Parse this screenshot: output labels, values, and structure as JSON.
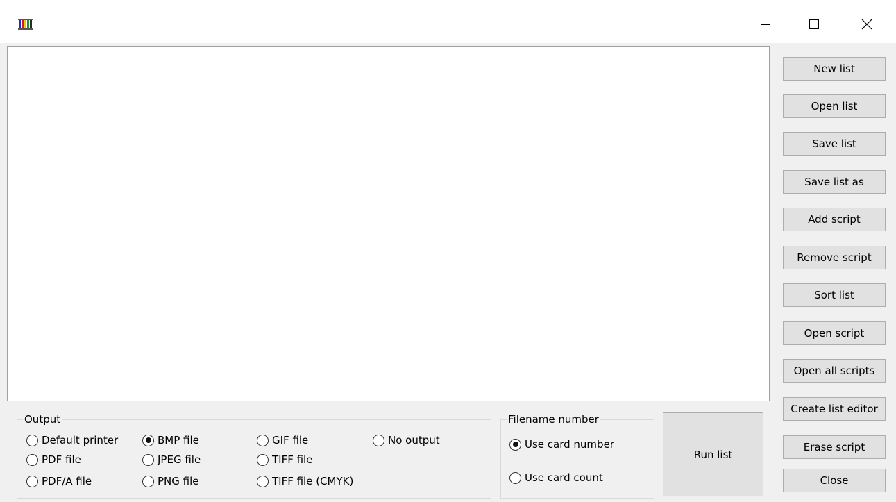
{
  "titlebar": {
    "controls": [
      "minimize-icon",
      "maximize-icon",
      "close-icon"
    ]
  },
  "sidebar": {
    "buttons": [
      {
        "label": "New list"
      },
      {
        "label": "Open list"
      },
      {
        "label": "Save list"
      },
      {
        "label": "Save list as"
      },
      {
        "label": "Add script"
      },
      {
        "label": "Remove script"
      },
      {
        "label": "Sort list"
      },
      {
        "label": "Open script"
      },
      {
        "label": "Open all scripts"
      },
      {
        "label": "Create list editor"
      },
      {
        "label": "Erase script"
      },
      {
        "label": "Close"
      }
    ]
  },
  "output": {
    "title": "Output",
    "options": [
      {
        "label": "Default printer",
        "checked": false
      },
      {
        "label": "BMP file",
        "checked": true
      },
      {
        "label": "GIF file",
        "checked": false
      },
      {
        "label": "No output",
        "checked": false
      },
      {
        "label": "PDF file",
        "checked": false
      },
      {
        "label": "JPEG file",
        "checked": false
      },
      {
        "label": "TIFF file",
        "checked": false
      },
      {
        "label": "PDF/A file",
        "checked": false
      },
      {
        "label": "PNG file",
        "checked": false
      },
      {
        "label": "TIFF file (CMYK)",
        "checked": false
      }
    ]
  },
  "filename_number": {
    "title": "Filename number",
    "options": [
      {
        "label": "Use card number",
        "checked": true
      },
      {
        "label": "Use card count",
        "checked": false
      }
    ]
  },
  "run": {
    "label": "Run list"
  },
  "colors": {
    "window_bg": "#f0f0f0",
    "titlebar_bg": "#ffffff",
    "button_bg": "#e1e1e1"
  }
}
